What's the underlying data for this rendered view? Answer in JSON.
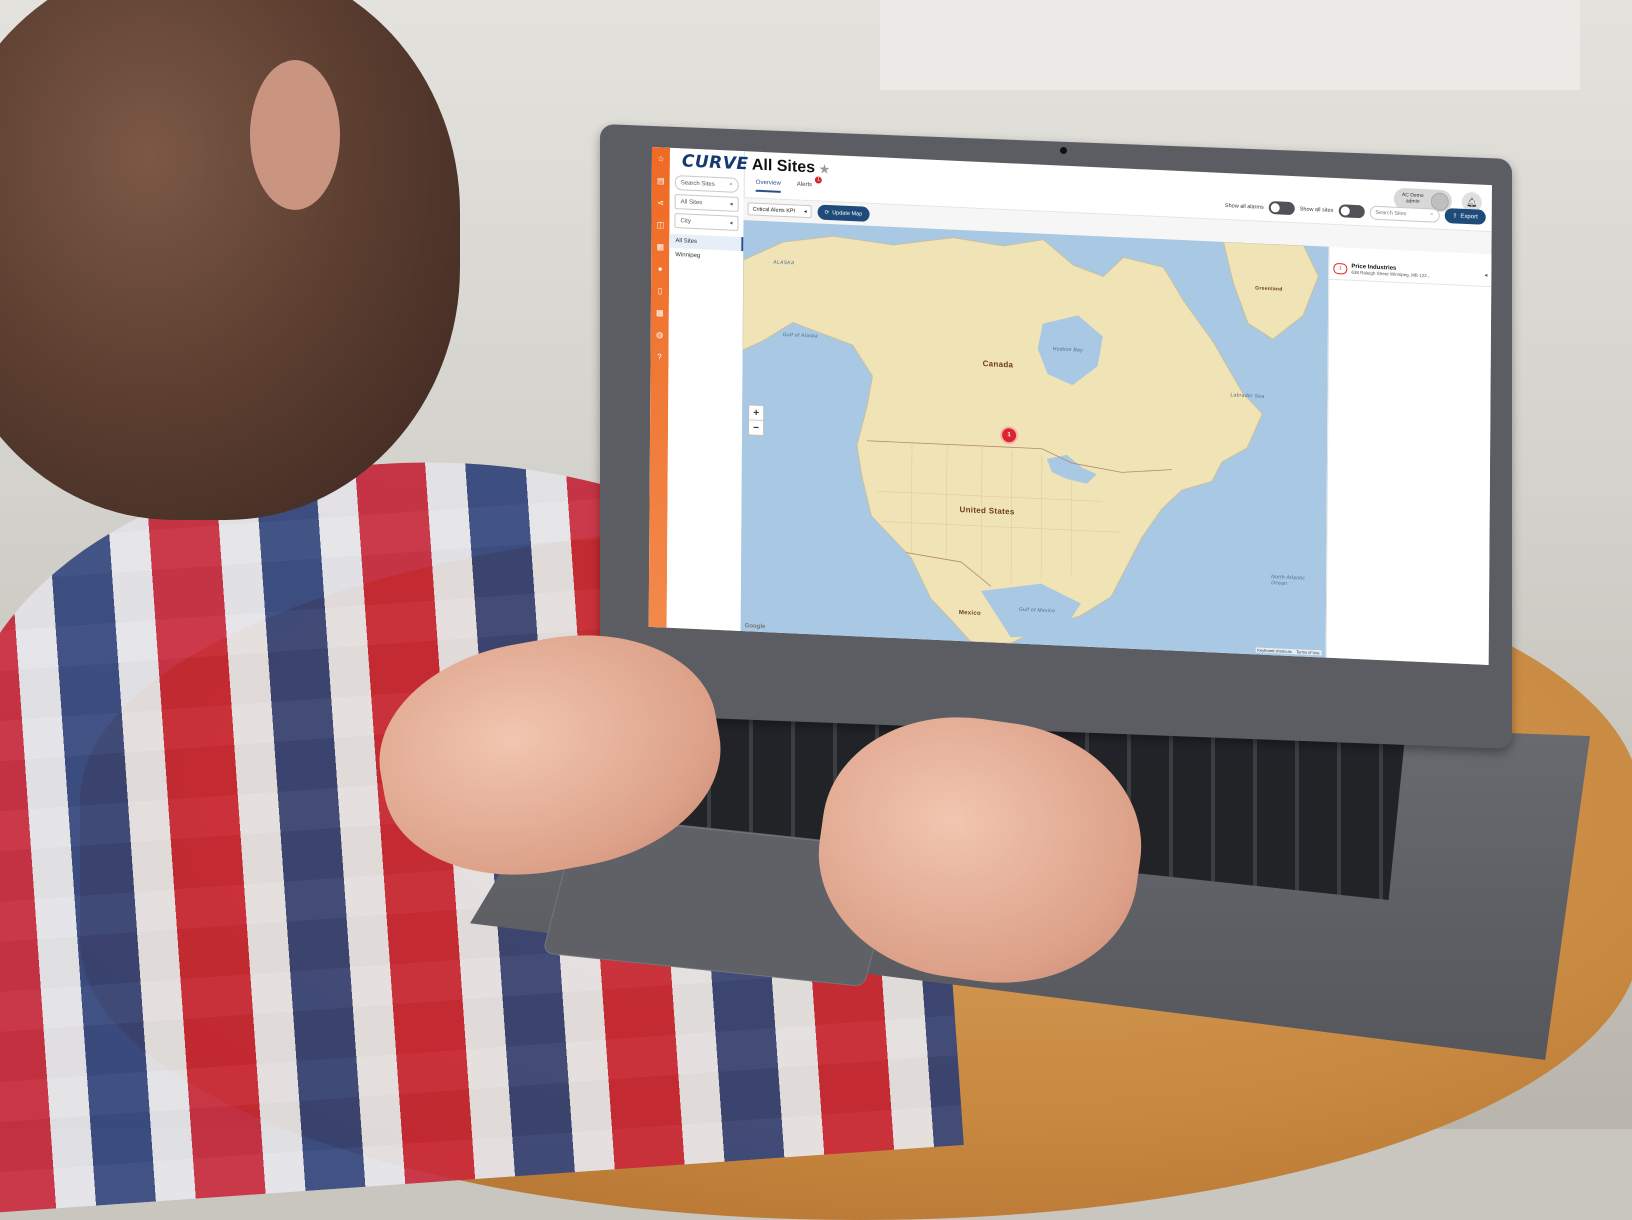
{
  "app": {
    "logo": "CURVE",
    "page_title": "All Sites"
  },
  "tabs": [
    {
      "label": "Overview",
      "active": true
    },
    {
      "label": "Alerts",
      "badge": "1"
    }
  ],
  "user": {
    "name": "AC Demo",
    "role": "admin"
  },
  "sidebar": {
    "search_placeholder": "Search Sites",
    "filter_scope": "All Sites",
    "filter_group": "City",
    "items": [
      {
        "label": "All Sites",
        "active": true
      },
      {
        "label": "Winnipeg"
      }
    ]
  },
  "toolbar": {
    "kpi_select": "Critical Alerts KPI",
    "update_button": "Update Map",
    "show_all_alarms": "Show all alarms",
    "show_all_sites": "Show all sites",
    "search_placeholder": "Search Sites",
    "export_button": "Export"
  },
  "map": {
    "zoom_in": "+",
    "zoom_out": "−",
    "marker_count": "1",
    "labels": {
      "canada": "Canada",
      "us": "United States",
      "greenland": "Greenland",
      "mexico": "Mexico",
      "hudson_bay": "Hudson Bay",
      "alaska": "ALASKA",
      "north_atlantic": "North Atlantic Ocean",
      "gulf_of_mexico": "Gulf of Mexico",
      "labrador_sea": "Labrador Sea",
      "gulf_of_alaska": "Gulf of Alaska"
    },
    "attribution": "Keyboard shortcuts",
    "terms": "Terms of Use",
    "provider": "Google"
  },
  "site_list": [
    {
      "badge": "1",
      "name": "Price Industries",
      "address": "638 Raleigh Street Winnipeg, MB 122..."
    }
  ],
  "colors": {
    "accent": "#ef6a24",
    "primary": "#1f4b7a",
    "alert": "#d9262d",
    "brand": "#143a73"
  }
}
